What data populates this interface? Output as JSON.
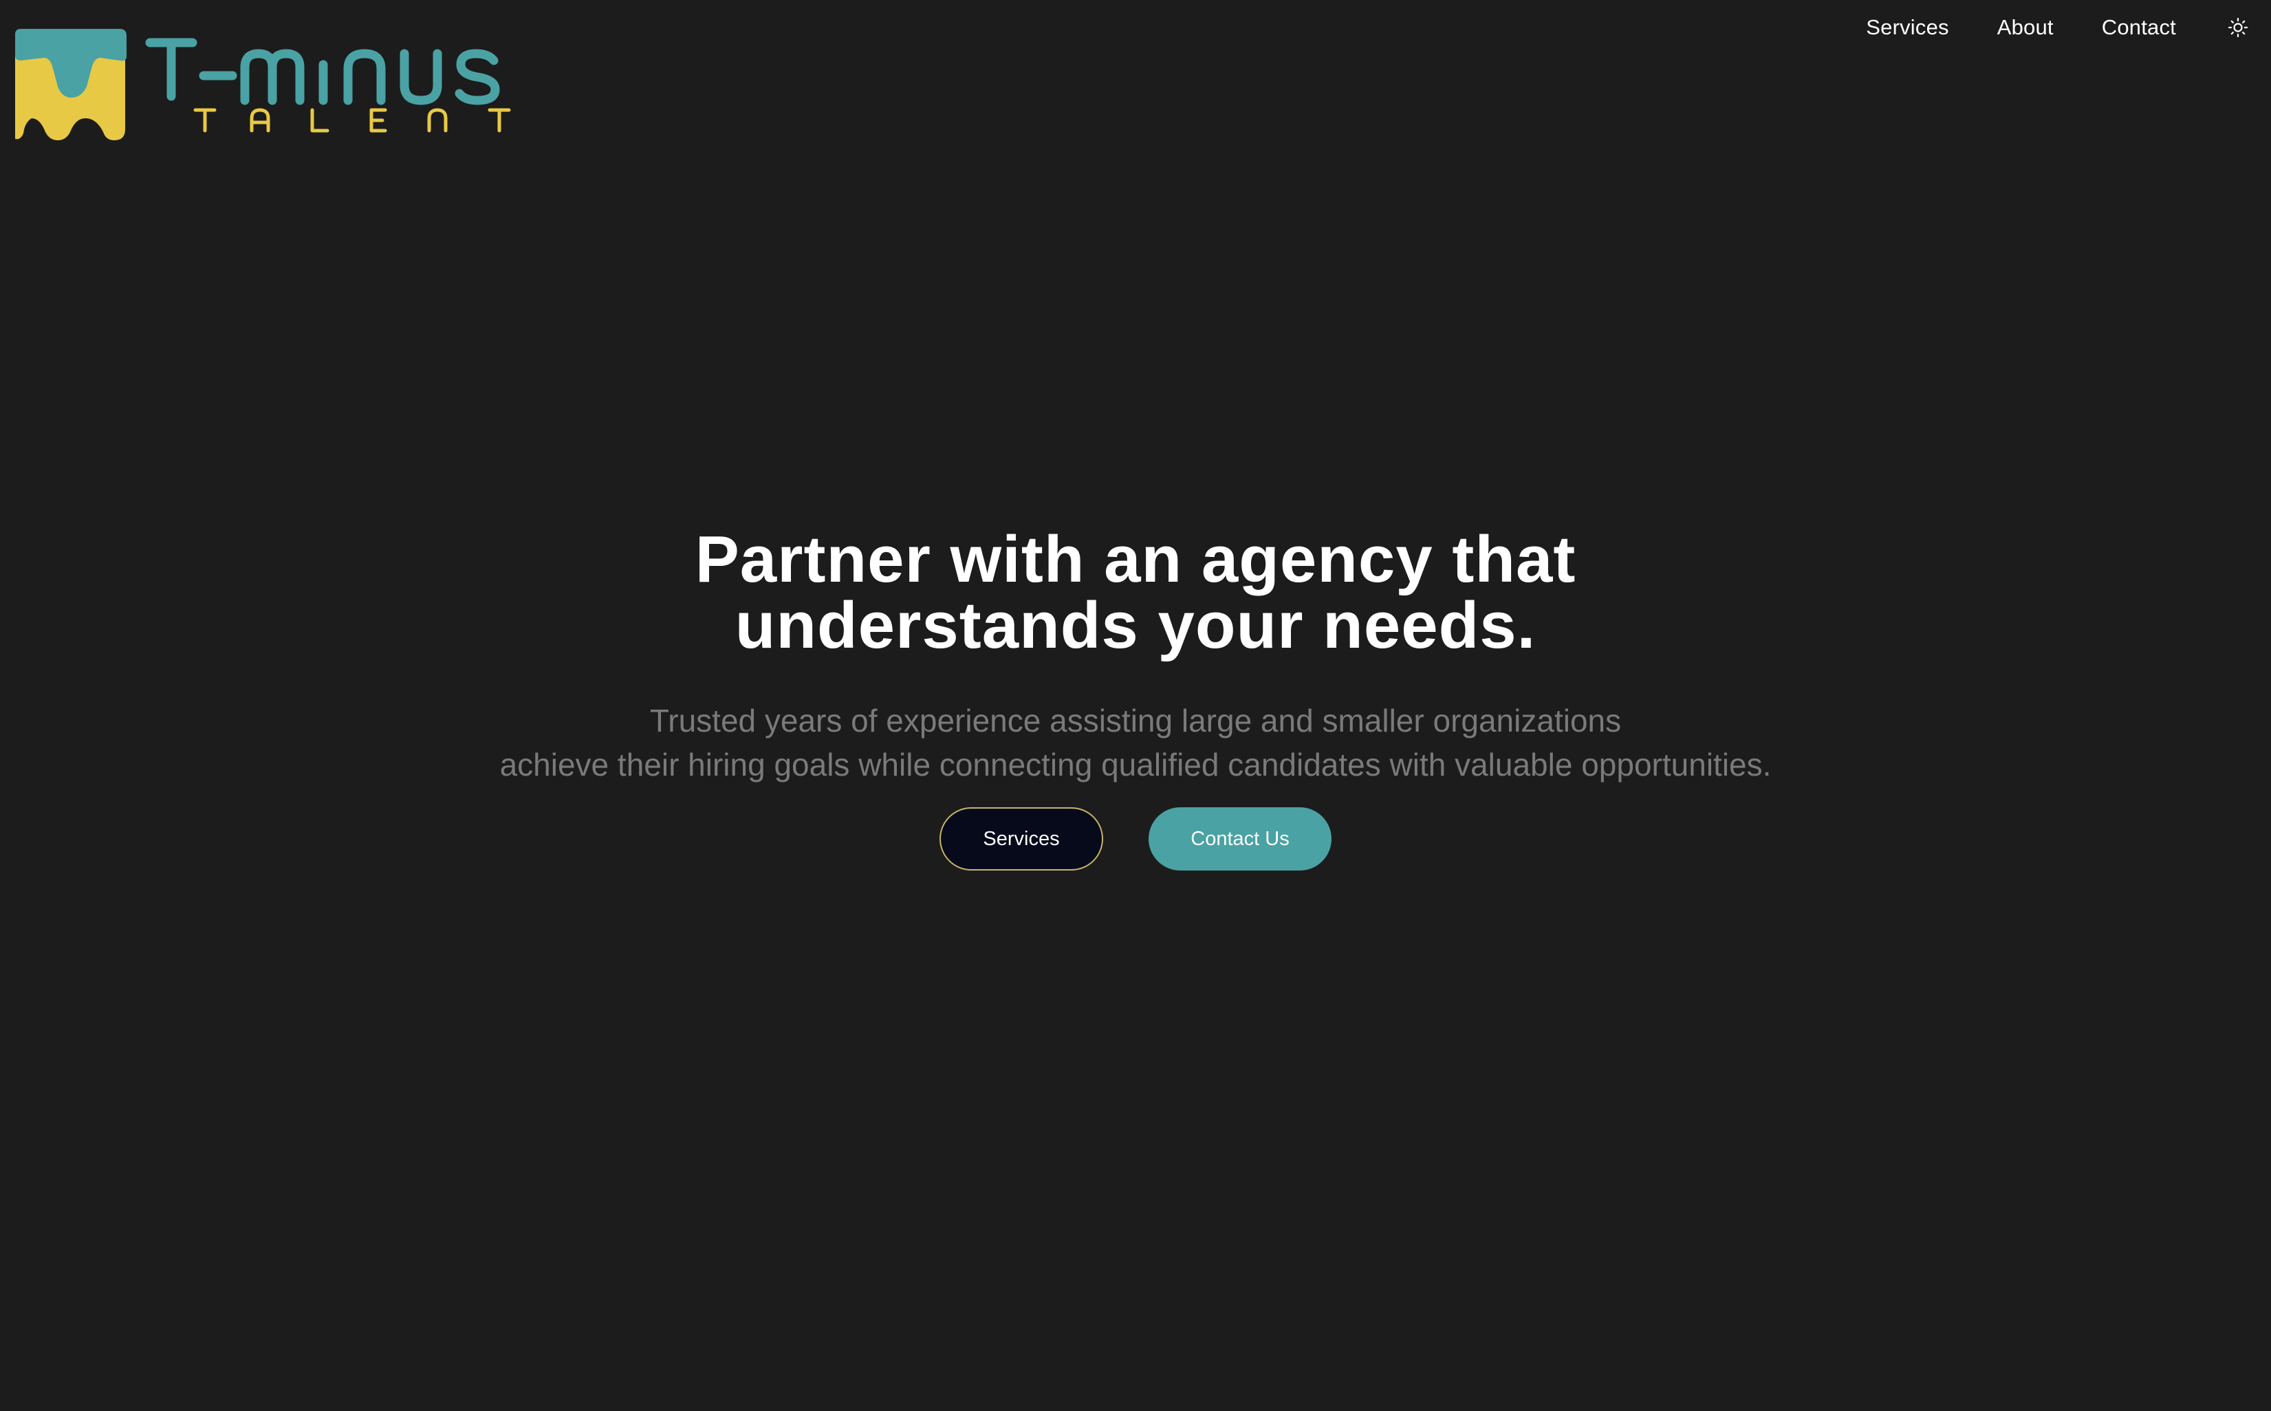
{
  "brand": {
    "name": "T-MINUS",
    "tagline": "TALENT",
    "colors": {
      "teal": "#4aa2a4",
      "yellow": "#e8c945"
    }
  },
  "nav": {
    "items": [
      {
        "label": "Services"
      },
      {
        "label": "About"
      },
      {
        "label": "Contact"
      }
    ],
    "theme_toggle_icon": "sun-icon"
  },
  "hero": {
    "title_line1": "Partner with an agency that",
    "title_line2": "understands your needs.",
    "subtitle_line1": "Trusted years of experience assisting large and smaller organizations",
    "subtitle_line2": "achieve their hiring goals while connecting qualified candidates with valuable opportunities.",
    "primary_button": "Services",
    "secondary_button": "Contact Us"
  },
  "colors": {
    "background": "#1c1c1c",
    "text": "#ffffff",
    "subtitle": "#7a7a7a",
    "services_button_bg": "#060a1b",
    "services_button_border": "#c9b565",
    "contact_button_bg": "#4aa2a4"
  }
}
